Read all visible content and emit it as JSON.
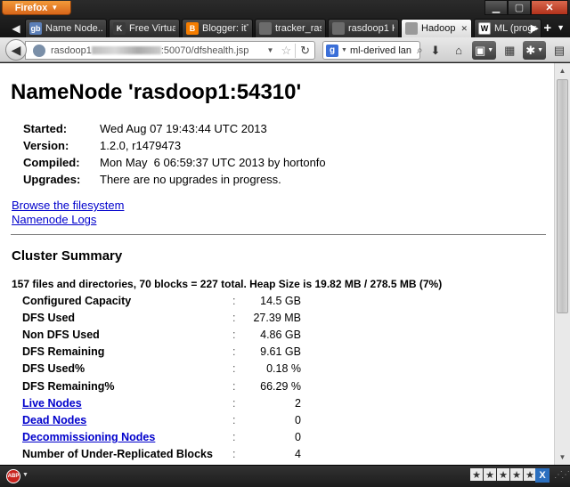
{
  "browser": {
    "menu_button": "Firefox",
    "tabs": [
      {
        "favicon": "gb",
        "favicon_color": "#5b7fb8",
        "title": "Name Node..."
      },
      {
        "favicon": "K",
        "favicon_color": "#3a3a3a",
        "title": "Free Virtual ..."
      },
      {
        "favicon": "B",
        "favicon_color": "#f57d00",
        "title": "Blogger: itT..."
      },
      {
        "favicon": "",
        "favicon_color": "#6b6b6b",
        "title": "tracker_rasd..."
      },
      {
        "favicon": "",
        "favicon_color": "#6b6b6b",
        "title": "rasdoop1 H..."
      },
      {
        "favicon": "",
        "favicon_color": "#9a9a9a",
        "title": "Hadoop ..."
      },
      {
        "favicon": "W",
        "favicon_color": "#ffffff",
        "title": "ML (progra..."
      }
    ],
    "active_tab_index": 5,
    "url_prefix": "rasdoop1",
    "url_suffix": ":50070/dfshealth.jsp",
    "search_engine": "g",
    "search_value": "ml-derived lan"
  },
  "page": {
    "title": "NameNode 'rasdoop1:54310'",
    "info": [
      {
        "key": "Started:",
        "value": "Wed Aug 07 19:43:44 UTC 2013"
      },
      {
        "key": "Version:",
        "value": "1.2.0, r1479473"
      },
      {
        "key": "Compiled:",
        "value": "Mon May  6 06:59:37 UTC 2013 by hortonfo"
      },
      {
        "key": "Upgrades:",
        "value": "There are no upgrades in progress."
      }
    ],
    "links": {
      "browse": "Browse the filesystem",
      "logs": "Namenode Logs"
    },
    "cluster_summary": {
      "title": "Cluster Summary",
      "summary": "157 files and directories, 70 blocks = 227 total. Heap Size is 19.82 MB / 278.5 MB (7%)",
      "separator": ":",
      "rows": [
        {
          "key": "Configured Capacity",
          "value": "14.5 GB"
        },
        {
          "key": "DFS Used",
          "value": "27.39 MB"
        },
        {
          "key": "Non DFS Used",
          "value": "4.86 GB"
        },
        {
          "key": "DFS Remaining",
          "value": "9.61 GB"
        },
        {
          "key": "DFS Used%",
          "value": "0.18 %"
        },
        {
          "key": "DFS Remaining%",
          "value": "66.29 %"
        },
        {
          "key": "Live Nodes",
          "value": "2"
        },
        {
          "key": "Dead Nodes",
          "value": "0"
        },
        {
          "key": "Decommissioning Nodes",
          "value": "0"
        },
        {
          "key": "Number of Under-Replicated Blocks",
          "value": "4"
        }
      ]
    }
  },
  "addon_bar": {
    "adblock_label": "ABP",
    "stars": "★",
    "x_label": "X"
  }
}
